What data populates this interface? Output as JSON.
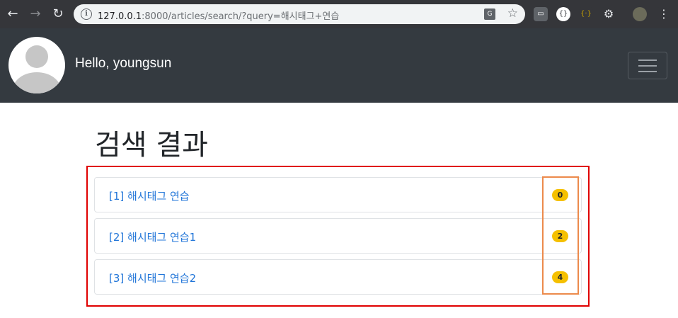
{
  "browser": {
    "url_host": "127.0.0.1",
    "url_rest": ":8000/articles/search/?query=해시태그+연습"
  },
  "header": {
    "greeting": "Hello, youngsun"
  },
  "main": {
    "title": "검색 결과",
    "results": [
      {
        "title": "[1] 해시태그 연습",
        "count": "0"
      },
      {
        "title": "[2] 해시태그 연습1",
        "count": "2"
      },
      {
        "title": "[3] 해시태그 연습2",
        "count": "4"
      }
    ]
  },
  "colors": {
    "navbar": "#343a40",
    "link": "#1f74d8",
    "badge": "#f5c000",
    "highlight_red": "#e00000",
    "highlight_orange": "#ec8a4c"
  }
}
